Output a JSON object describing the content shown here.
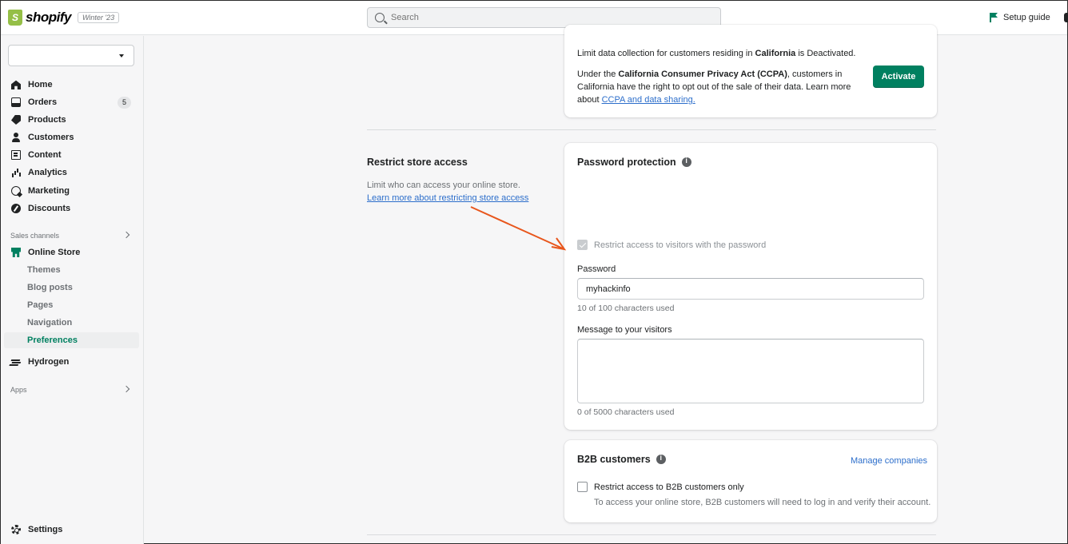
{
  "topbar": {
    "brand": "shopify",
    "edition": "Winter '23",
    "search_placeholder": "Search",
    "setup_guide": "Setup guide"
  },
  "sidebar": {
    "store_select_value": "",
    "nav": [
      {
        "label": "Home",
        "icon": "home-icon"
      },
      {
        "label": "Orders",
        "icon": "orders-icon",
        "badge": "5"
      },
      {
        "label": "Products",
        "icon": "tag-icon"
      },
      {
        "label": "Customers",
        "icon": "person-icon"
      },
      {
        "label": "Content",
        "icon": "content-icon"
      },
      {
        "label": "Analytics",
        "icon": "bar-chart-icon"
      },
      {
        "label": "Marketing",
        "icon": "target-icon"
      },
      {
        "label": "Discounts",
        "icon": "discount-icon"
      }
    ],
    "sales_channels_label": "Sales channels",
    "online_store": "Online Store",
    "online_store_sub": [
      "Themes",
      "Blog posts",
      "Pages",
      "Navigation",
      "Preferences"
    ],
    "hydrogen": "Hydrogen",
    "apps_label": "Apps",
    "settings": "Settings",
    "active_color": "#008060"
  },
  "privacy_card": {
    "line1_pre": "Limit data collection for customers residing in ",
    "line1_bold": "California",
    "line1_post": " is Deactivated.",
    "line2_pre": "Under the ",
    "line2_bold": "California Consumer Privacy Act (CCPA)",
    "line2_mid": ", customers in California have the right to opt out of the sale of their data. Learn more about ",
    "line2_link": "CCPA and data sharing.",
    "activate_button": "Activate"
  },
  "restrict_section": {
    "title": "Restrict store access",
    "description": "Limit who can access your online store. ",
    "link": "Learn more about restricting store access"
  },
  "password_card": {
    "title": "Password protection",
    "checkbox_label": "Restrict access to visitors with the password",
    "checkbox_checked": true,
    "password_label": "Password",
    "password_value": "myhackinfo",
    "password_help": "10 of 100 characters used",
    "message_label": "Message to your visitors",
    "message_value": "",
    "message_help": "0 of 5000 characters used"
  },
  "b2b_card": {
    "title": "B2B customers",
    "manage_link": "Manage companies",
    "checkbox_label": "Restrict access to B2B customers only",
    "checkbox_checked": false,
    "help": "To access your online store, B2B customers will need to log in and verify their account."
  },
  "annotation": {
    "arrow_color": "#e8561c"
  }
}
